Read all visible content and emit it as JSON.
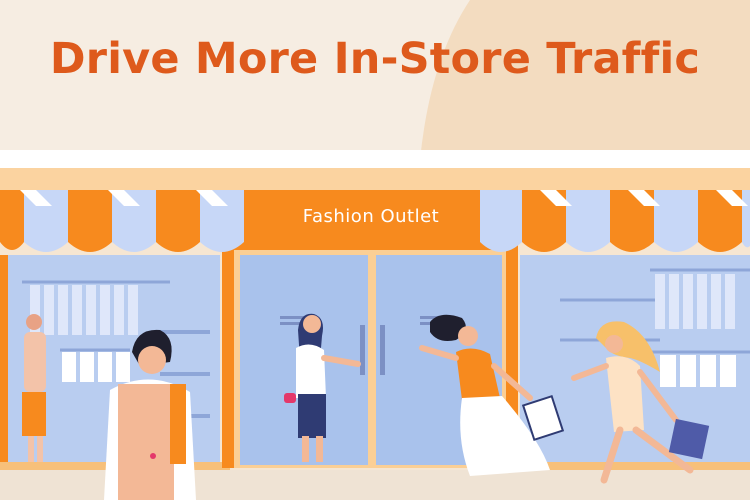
{
  "header": {
    "title": "Drive More In-Store Traffic"
  },
  "storefront": {
    "sign_text": "Fashion Outlet"
  },
  "colors": {
    "background": "#f6ede2",
    "title": "#de5a1c",
    "awning_orange": "#f78a1e",
    "awning_blue": "#c7d7f7",
    "window_glass": "#b9cdf0"
  },
  "icons": [
    "shopper-figures",
    "clothing-racks",
    "shopping-bags"
  ]
}
